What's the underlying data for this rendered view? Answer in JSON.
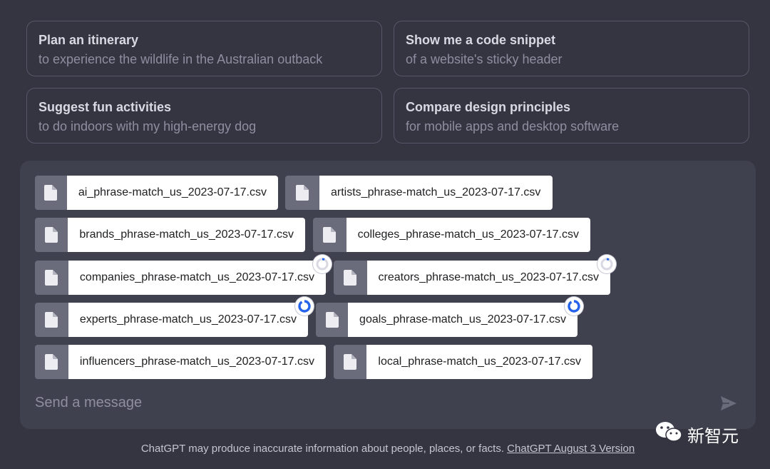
{
  "suggestions": [
    {
      "title": "Plan an itinerary",
      "subtitle": "to experience the wildlife in the Australian outback"
    },
    {
      "title": "Show me a code snippet",
      "subtitle": "of a website's sticky header"
    },
    {
      "title": "Suggest fun activities",
      "subtitle": "to do indoors with my high-energy dog"
    },
    {
      "title": "Compare design principles",
      "subtitle": "for mobile apps and desktop software"
    }
  ],
  "attachments": [
    {
      "name": "ai_phrase-match_us_2023-07-17.csv",
      "icon": "file-icon"
    },
    {
      "name": "artists_phrase-match_us_2023-07-17.csv",
      "icon": "file-icon"
    },
    {
      "name": "brands_phrase-match_us_2023-07-17.csv",
      "icon": "file-icon"
    },
    {
      "name": "colleges_phrase-match_us_2023-07-17.csv",
      "icon": "file-icon"
    },
    {
      "name": "companies_phrase-match_us_2023-07-17.csv",
      "icon": "file-icon",
      "upload_status": "loading"
    },
    {
      "name": "creators_phrase-match_us_2023-07-17.csv",
      "icon": "file-icon",
      "upload_status": "loading"
    },
    {
      "name": "experts_phrase-match_us_2023-07-17.csv",
      "icon": "file-icon",
      "upload_status": "uploading"
    },
    {
      "name": "goals_phrase-match_us_2023-07-17.csv",
      "icon": "file-icon",
      "upload_status": "uploading"
    },
    {
      "name": "influencers_phrase-match_us_2023-07-17.csv",
      "icon": "file-icon"
    },
    {
      "name": "local_phrase-match_us_2023-07-17.csv",
      "icon": "file-icon"
    }
  ],
  "composer": {
    "placeholder": "Send a message",
    "send_icon": "send-icon"
  },
  "footer": {
    "text": "ChatGPT may produce inaccurate information about people, places, or facts.",
    "link": "ChatGPT August 3 Version"
  },
  "watermark": {
    "text": "新智元",
    "icon": "wechat-icon"
  },
  "colors": {
    "background": "#343541",
    "composer": "#40414f",
    "border": "#565869",
    "spinner_active": "#2563eb"
  }
}
